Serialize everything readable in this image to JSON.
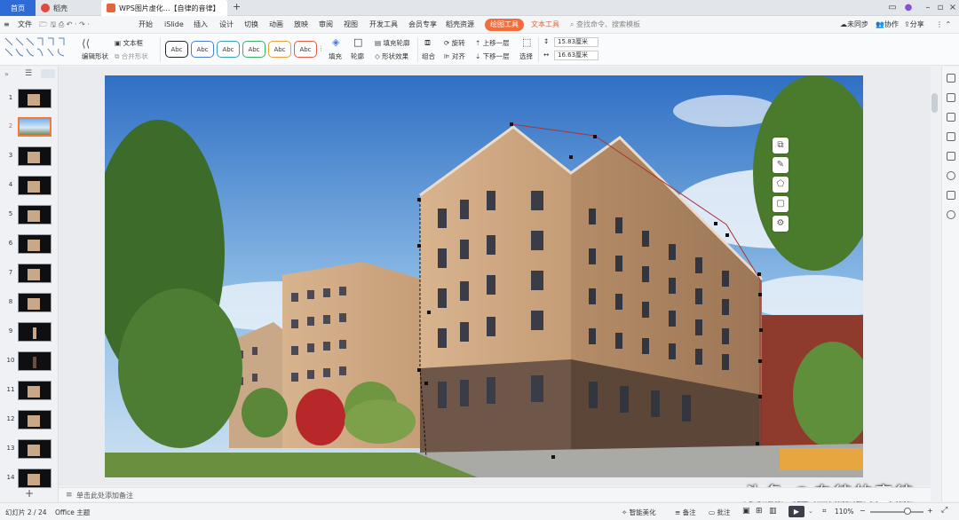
{
  "titlebar": {
    "home_tab": "首页",
    "docer_tab": "稻壳",
    "doc_tab": "WPS图片虚化...【自律的音律】",
    "add_tab": "+"
  },
  "menubar": {
    "file": "文件",
    "items": [
      "开始",
      "iSlide",
      "插入",
      "设计",
      "切换",
      "动画",
      "放映",
      "审阅",
      "视图",
      "开发工具",
      "会员专享",
      "稻壳资源"
    ],
    "picture_tools": "绘图工具",
    "text_tools": "文本工具",
    "search": "查找命令、搜索模板",
    "sync": "未同步",
    "collab": "协作",
    "share": "分享"
  },
  "ribbon": {
    "edit_shape": "编辑形状",
    "textbox": "文本框",
    "merge_shape": "合并形状",
    "style_label": "Abc",
    "fill": "填充",
    "outline": "轮廓",
    "fill_outline": "填充轮廓",
    "shape_effect": "形状效果",
    "group": "组合",
    "rotate": "旋转",
    "align": "对齐",
    "bring_forward": "上移一层",
    "send_backward": "下移一层",
    "select": "选择",
    "height": "15.83厘米",
    "width": "16.63厘米"
  },
  "slides": {
    "numbers": [
      "1",
      "2",
      "3",
      "4",
      "5",
      "6",
      "7",
      "8",
      "9",
      "10",
      "11",
      "12",
      "13",
      "14"
    ],
    "add_label": "+"
  },
  "notes": {
    "placeholder": "单击此处添加备注"
  },
  "watermark": "头条 @自律的音律",
  "statusbar": {
    "slide_info": "幻灯片 2 / 24",
    "theme": "Office 主题",
    "smart": "智能美化",
    "notes": "备注",
    "comments": "批注",
    "zoom": "110%"
  }
}
